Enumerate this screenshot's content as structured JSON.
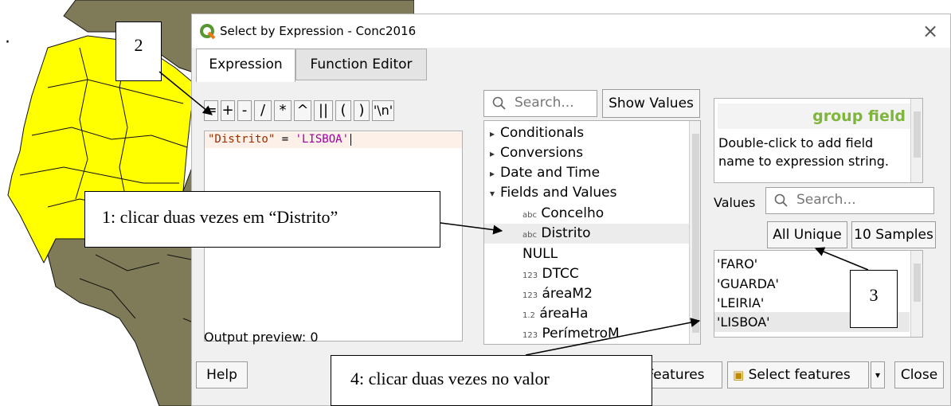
{
  "dialog": {
    "title": "Select by Expression - Conc2016",
    "close_glyph": "×",
    "tabs": [
      "Expression",
      "Function Editor"
    ],
    "operators": [
      "=",
      "+",
      "-",
      "/",
      "*",
      "^",
      "||",
      "(",
      ")",
      "'\\n'"
    ],
    "expression": {
      "field": "\"Distrito\"",
      "op": " = ",
      "value": "'LISBOA'"
    },
    "output_preview": "Output preview: 0",
    "search_placeholder": "Search...",
    "show_values_label": "Show Values",
    "tree": [
      {
        "arrow": "▸",
        "label": "Conditionals"
      },
      {
        "arrow": "▸",
        "label": "Conversions"
      },
      {
        "arrow": "▸",
        "label": "Date and Time"
      },
      {
        "arrow": "▾",
        "label": "Fields and Values"
      }
    ],
    "fields": [
      {
        "type": "abc",
        "label": "Concelho"
      },
      {
        "type": "abc",
        "label": "Distrito"
      },
      {
        "type": "",
        "label": "NULL"
      },
      {
        "type": "123",
        "label": "DTCC"
      },
      {
        "type": "123",
        "label": "áreaM2"
      },
      {
        "type": "1.2",
        "label": "áreaHa"
      },
      {
        "type": "123",
        "label": "PerímetroM"
      }
    ],
    "info": {
      "heading": "group field",
      "description": "Double-click to add field name to expression string."
    },
    "values_label": "Values",
    "values_search_placeholder": "Search...",
    "all_unique_label": "All Unique",
    "samples_label": "10 Samples",
    "values": [
      "'FARO'",
      "'GUARDA'",
      "'LEIRIA'",
      "'LISBOA'"
    ],
    "help_label": "Help",
    "features_label": "Features",
    "select_features_label": "Select features",
    "close_label": "Close"
  },
  "callouts": {
    "c1": "1: clicar duas vezes em “Distrito”",
    "c2": "2",
    "c3": "3",
    "c4": "4: clicar duas vezes no valor"
  },
  "colors": {
    "map_selected": "#ffff00",
    "map_other": "#7f7a57",
    "field_name": "#9b2d00",
    "string_value": "#a000a0",
    "group_heading": "#7fb53a"
  }
}
